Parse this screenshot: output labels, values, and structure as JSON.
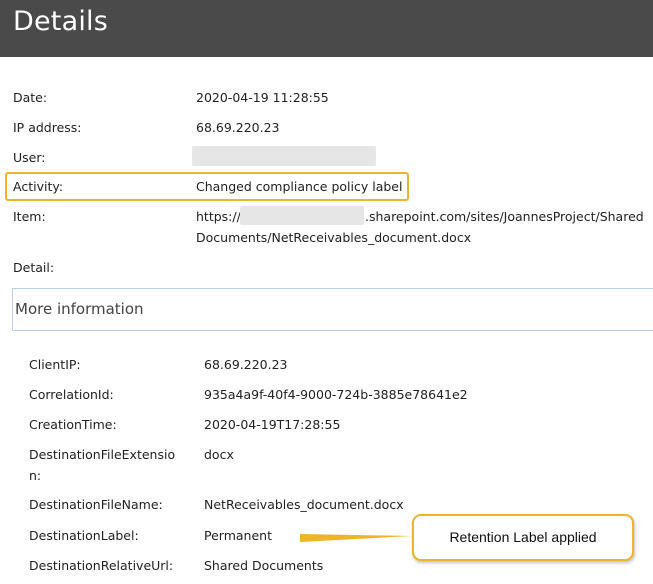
{
  "header": {
    "title": "Details"
  },
  "fields": {
    "date": {
      "label": "Date:",
      "value": "2020-04-19 11:28:55"
    },
    "ip": {
      "label": "IP address:",
      "value": "68.69.220.23"
    },
    "user": {
      "label": "User:"
    },
    "activity": {
      "label": "Activity:",
      "value": "Changed compliance policy label"
    },
    "item": {
      "label": "Item:",
      "value_prefix": "https://",
      "value_line1_suffix": ".sharepoint.com/sites/JoannesProject/Shared",
      "value_line2": "Documents/NetReceivables_document.docx"
    },
    "detail": {
      "label": "Detail:"
    }
  },
  "more_info": {
    "label": "More information"
  },
  "info_rows": {
    "client_ip": {
      "label": "ClientIP:",
      "value": "68.69.220.23"
    },
    "correlation_id": {
      "label": "CorrelationId:",
      "value": "935a4a9f-40f4-9000-724b-3885e78641e2"
    },
    "creation_time": {
      "label": "CreationTime:",
      "value": "2020-04-19T17:28:55"
    },
    "destination_file_extension": {
      "label_line1": "DestinationFileExtensio",
      "label_line2": "n:",
      "value": "docx"
    },
    "destination_file_name": {
      "label": "DestinationFileName:",
      "value": "NetReceivables_document.docx"
    },
    "destination_label": {
      "label": "DestinationLabel:",
      "value": "Permanent"
    },
    "destination_relative_url": {
      "label": "DestinationRelativeUrl:",
      "value": "Shared Documents"
    }
  },
  "callout": {
    "text": "Retention Label applied"
  },
  "colors": {
    "header_bg": "#4a4a4a",
    "highlight": "#f0b429",
    "more_info_border": "#b9cfe8"
  }
}
